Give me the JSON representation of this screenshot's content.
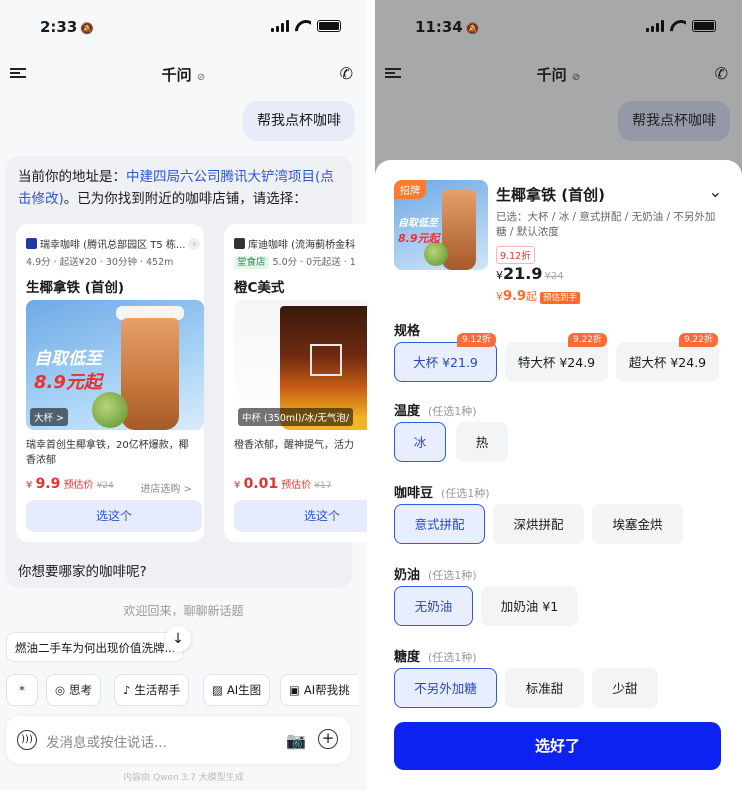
{
  "left": {
    "status": {
      "time": "2:33"
    },
    "header": {
      "title": "千问"
    },
    "user_message": "帮我点杯咖啡",
    "reply": {
      "prefix": "当前你的地址是：",
      "address_link": "中建四局六公司腾讯大铲湾项目",
      "modify_link": "(点击修改)",
      "suffix": "。已为你找到附近的咖啡店铺，请选择：",
      "question": "你想要哪家的咖啡呢?"
    },
    "cards": [
      {
        "store": "瑞幸咖啡 (腾讯总部园区 T5 栋...",
        "meta": "4.9分 · 起送¥20 · 30分钟 · 452m",
        "product": "生椰拿铁 (首创)",
        "promo_line1": "自取低至",
        "promo_line2": "8.9元起",
        "size_tag": "大杯 >",
        "desc": "瑞幸首创生椰拿铁，20亿杯爆款，椰香浓郁",
        "price_symbol": "¥",
        "price": "9.9",
        "price_note": "预估价",
        "orig_price": "¥24",
        "store_link": "进店选购 >",
        "button": "选这个"
      },
      {
        "store": "库迪咖啡 (流海蓟桥金科",
        "meta_tag": "堂食店",
        "meta": "5.0分 · 0元起送 · 1",
        "product": "橙C美式",
        "size_tag": "中杯 (350ml)/冰/无气泡/",
        "desc": "橙香浓郁，醒神提气，活力",
        "price_symbol": "¥",
        "price": "0.01",
        "price_note": "预估价",
        "orig_price": "¥17",
        "button": "选这个"
      }
    ],
    "welcome": "欢迎回来，聊聊新话题",
    "suggestion": "燃油二手车为何出现价值洗牌...",
    "chips": [
      {
        "icon": "*",
        "label": ""
      },
      {
        "icon": "◎",
        "label": "思考"
      },
      {
        "icon": "♪",
        "label": "生活帮手"
      },
      {
        "icon": "▨",
        "label": "AI生图"
      },
      {
        "icon": "▣",
        "label": "AI帮我挑"
      }
    ],
    "input": {
      "placeholder": "发消息或按住说话..."
    },
    "footnote": "内容由 Qwen 3.7 大模型生成"
  },
  "right": {
    "status": {
      "time": "11:34"
    },
    "header": {
      "title": "千问"
    },
    "user_message": "帮我点杯咖啡",
    "product": {
      "badge": "招牌",
      "name": "生椰拿铁 (首创)",
      "selected": "已选：大杯 / 冰 / 意式拼配 / 无奶油 / 不另外加糖 / 默认浓度",
      "discount": "9.12折",
      "price_symbol": "¥",
      "price": "21.9",
      "orig_price": "¥24",
      "est_symbol": "¥",
      "est_price": "9.9",
      "est_suffix": "起",
      "est_tag": "预估到手",
      "promo_line1": "自取低至",
      "promo_line2": "8.9元起"
    },
    "sections": {
      "size": {
        "title": "规格",
        "options": [
          {
            "label": "大杯 ¥21.9",
            "badge": "9.12折",
            "selected": true
          },
          {
            "label": "特大杯 ¥24.9",
            "badge": "9.22折",
            "selected": false
          },
          {
            "label": "超大杯 ¥24.9",
            "badge": "9.22折",
            "selected": false
          }
        ]
      },
      "temp": {
        "title": "温度",
        "hint": "(任选1种)",
        "options": [
          {
            "label": "冰",
            "selected": true
          },
          {
            "label": "热",
            "selected": false
          }
        ]
      },
      "bean": {
        "title": "咖啡豆",
        "hint": "(任选1种)",
        "options": [
          {
            "label": "意式拼配",
            "selected": true
          },
          {
            "label": "深烘拼配",
            "selected": false
          },
          {
            "label": "埃塞金烘",
            "selected": false
          }
        ]
      },
      "cream": {
        "title": "奶油",
        "hint": "(任选1种)",
        "options": [
          {
            "label": "无奶油",
            "selected": true
          },
          {
            "label": "加奶油 ¥1",
            "selected": false
          }
        ]
      },
      "sugar": {
        "title": "糖度",
        "hint": "(任选1种)",
        "options": [
          {
            "label": "不另外加糖",
            "selected": true
          },
          {
            "label": "标准甜",
            "selected": false
          },
          {
            "label": "少甜",
            "selected": false
          }
        ]
      }
    },
    "cta": "选好了"
  },
  "colors": {
    "accent": "#0c22f0",
    "link": "#2b56d8",
    "price_red": "#e8322f",
    "orange": "#ff6a2a"
  }
}
